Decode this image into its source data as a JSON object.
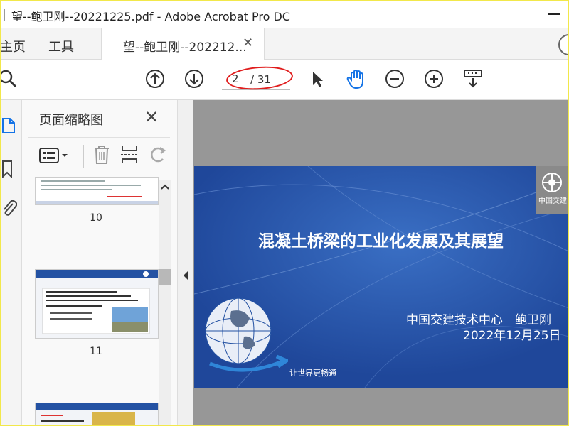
{
  "window": {
    "title": "望--鲍卫刚--20221225.pdf - Adobe Acrobat Pro DC"
  },
  "tabs": {
    "home": "主页",
    "tools": "工具",
    "document": "望--鲍卫刚--202212..."
  },
  "toolbar": {
    "current_page": "2",
    "total_pages": "/ 31"
  },
  "thumbnail_panel": {
    "title": "页面缩略图",
    "pages": [
      {
        "number": "10"
      },
      {
        "number": "11"
      }
    ]
  },
  "slide": {
    "title": "混凝土桥梁的工业化发展及其展望",
    "organization": "中国交建技术中心　鲍卫刚",
    "date": "2022年12月25日",
    "slogan": "让世界更畅通",
    "logo_text": "中国交建"
  }
}
